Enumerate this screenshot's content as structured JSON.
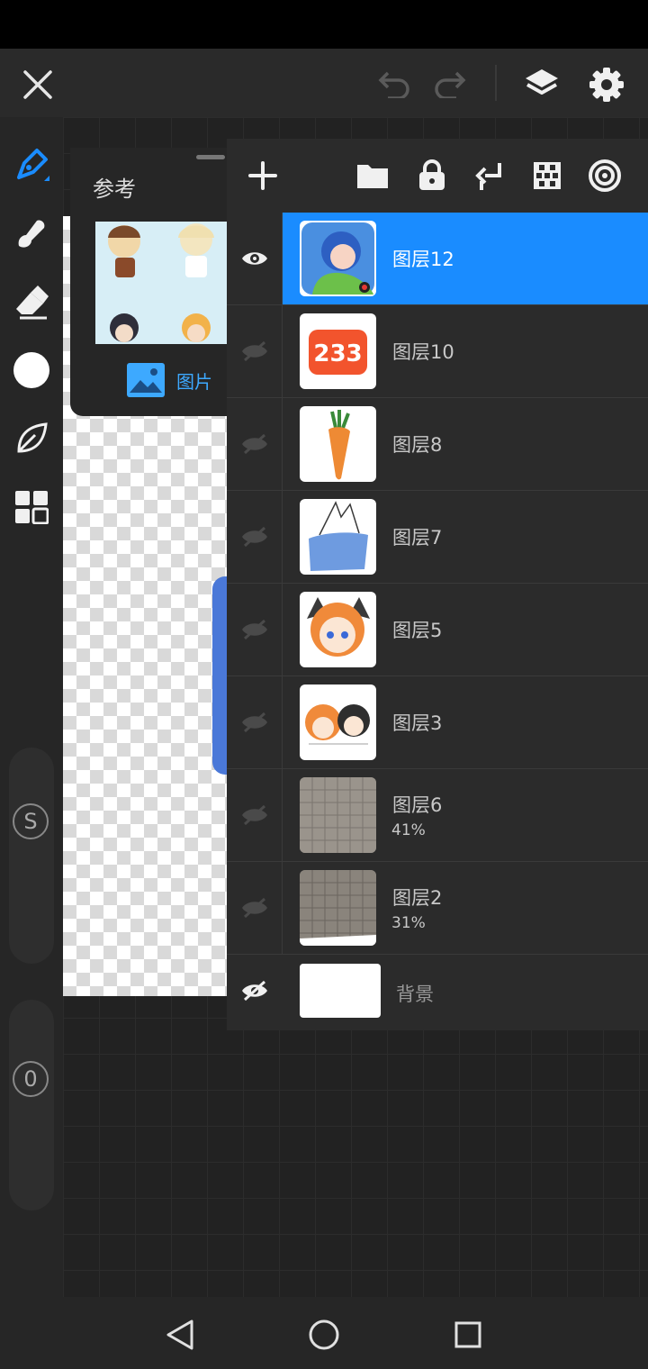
{
  "app": {
    "accent": "#1a8cff"
  },
  "topbar": {
    "close_icon": "close-icon",
    "undo_icon": "undo-icon",
    "redo_icon": "redo-icon",
    "layers_icon": "layers-icon",
    "settings_icon": "gear-icon"
  },
  "left_toolbar": {
    "tools": [
      "brush",
      "smudge",
      "eraser",
      "color",
      "leaf",
      "grid"
    ],
    "active_tool": "brush",
    "color": "#ffffff",
    "size_slider_label": "S",
    "opacity_slider_label": "0"
  },
  "reference_panel": {
    "title": "参考",
    "footer_label": "图片"
  },
  "layers_panel": {
    "tools": [
      "add",
      "folder",
      "lock",
      "merge-down",
      "transparency",
      "onion"
    ],
    "layers": [
      {
        "name": "图层12",
        "visible": true,
        "selected": true,
        "opacity": "",
        "thumb": "avatar"
      },
      {
        "name": "图层10",
        "visible": false,
        "selected": false,
        "opacity": "",
        "thumb": "233"
      },
      {
        "name": "图层8",
        "visible": false,
        "selected": false,
        "opacity": "",
        "thumb": "carrot"
      },
      {
        "name": "图层7",
        "visible": false,
        "selected": false,
        "opacity": "",
        "thumb": "sketch"
      },
      {
        "name": "图层5",
        "visible": false,
        "selected": false,
        "opacity": "",
        "thumb": "cat-girl"
      },
      {
        "name": "图层3",
        "visible": false,
        "selected": false,
        "opacity": "",
        "thumb": "two-kids"
      },
      {
        "name": "图层6",
        "visible": false,
        "selected": false,
        "opacity": "41%",
        "thumb": "paper"
      },
      {
        "name": "图层2",
        "visible": false,
        "selected": false,
        "opacity": "31%",
        "thumb": "paper"
      }
    ],
    "background": {
      "name": "背景",
      "visible": false
    },
    "thumb_233_text": "233"
  },
  "navbar": {
    "back": "back-icon",
    "home": "home-icon",
    "recents": "recents-icon"
  }
}
